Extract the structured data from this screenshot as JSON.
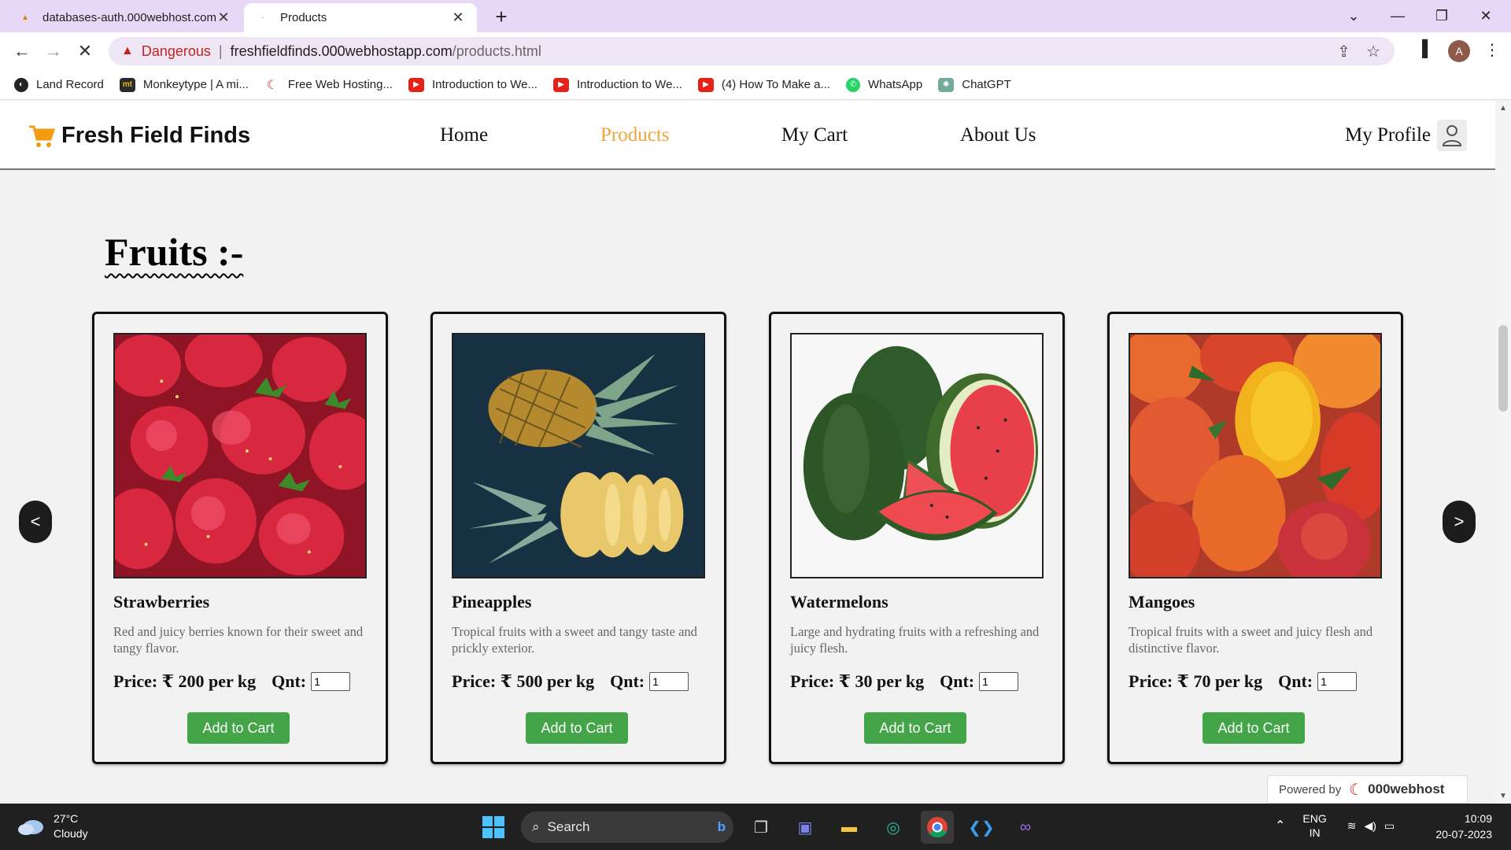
{
  "browser": {
    "tabs": [
      {
        "title": "databases-auth.000webhost.com",
        "active": false
      },
      {
        "title": "Products",
        "active": true
      }
    ],
    "address": {
      "security_label": "Dangerous",
      "host": "freshfieldfinds.000webhostapp.com",
      "path": "/products.html"
    },
    "profile_initial": "A",
    "bookmarks": [
      {
        "label": "Land Record",
        "icon": "globe-icon"
      },
      {
        "label": "Monkeytype | A mi...",
        "icon": "monkeytype-icon"
      },
      {
        "label": "Free Web Hosting...",
        "icon": "webhost-icon"
      },
      {
        "label": "Introduction to We...",
        "icon": "youtube-icon"
      },
      {
        "label": "Introduction to We...",
        "icon": "youtube-icon"
      },
      {
        "label": "(4) How To Make a...",
        "icon": "youtube-icon"
      },
      {
        "label": "WhatsApp",
        "icon": "whatsapp-icon"
      },
      {
        "label": "ChatGPT",
        "icon": "chatgpt-icon"
      }
    ]
  },
  "site": {
    "brand": "Fresh Field Finds",
    "nav": {
      "home": "Home",
      "products": "Products",
      "cart": "My Cart",
      "about": "About Us",
      "profile": "My Profile"
    },
    "active_nav_color": "#f2a33a",
    "section_title": "Fruits :-",
    "prev_label": "<",
    "next_label": ">",
    "products": [
      {
        "name": "Strawberries",
        "desc": "Red and juicy berries known for their sweet and tangy flavor.",
        "price": "Price: ₹ 200 per kg",
        "qnt_label": "Qnt:",
        "qnt": "1",
        "button": "Add to Cart"
      },
      {
        "name": "Pineapples",
        "desc": "Tropical fruits with a sweet and tangy taste and prickly exterior.",
        "price": "Price: ₹ 500 per kg",
        "qnt_label": "Qnt:",
        "qnt": "1",
        "button": "Add to Cart"
      },
      {
        "name": "Watermelons",
        "desc": "Large and hydrating fruits with a refreshing and juicy flesh.",
        "price": "Price: ₹ 30 per kg",
        "qnt_label": "Qnt:",
        "qnt": "1",
        "button": "Add to Cart"
      },
      {
        "name": "Mangoes",
        "desc": "Tropical fruits with a sweet and juicy flesh and distinctive flavor.",
        "price": "Price: ₹ 70 per kg",
        "qnt_label": "Qnt:",
        "qnt": "1",
        "button": "Add to Cart"
      }
    ],
    "button_color": "#43a548",
    "powered_by": "Powered by",
    "powered_brand": "000webhost"
  },
  "taskbar": {
    "temperature": "27°C",
    "weather": "Cloudy",
    "search_label": "Search",
    "lang_top": "ENG",
    "lang_bottom": "IN",
    "time": "10:09",
    "date": "20-07-2023"
  }
}
